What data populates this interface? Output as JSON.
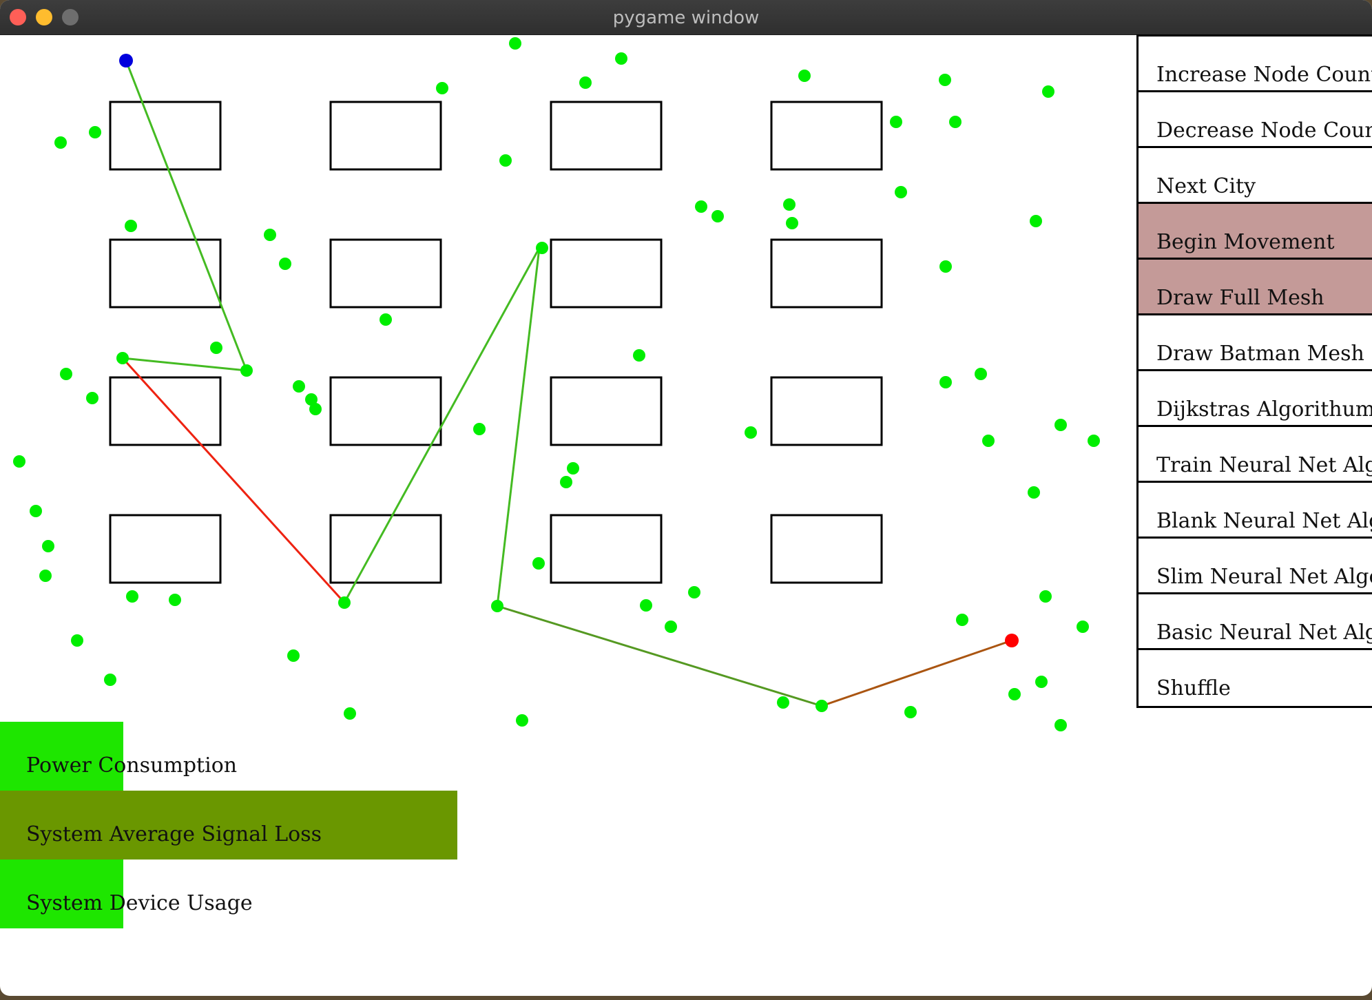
{
  "window": {
    "title": "pygame window",
    "traffic_lights": [
      {
        "name": "close",
        "color": "#ff5f57"
      },
      {
        "name": "minimize",
        "color": "#febc2e"
      },
      {
        "name": "zoom",
        "color": "#6e6e6e"
      }
    ]
  },
  "colors": {
    "node": "#00ee00",
    "start_node": "#0000dd",
    "end_node": "#ff0000",
    "path_green": "#44bb22",
    "path_red": "#ee2211",
    "path_olive": "#559922",
    "path_brown": "#aa5511",
    "button_active": "#c49a98",
    "meter_bright": "#1ee600",
    "meter_olive": "#6a9700"
  },
  "menu": {
    "buttons": [
      {
        "label": "Increase Node Count",
        "active": false
      },
      {
        "label": "Decrease Node Count",
        "active": false
      },
      {
        "label": "Next City",
        "active": false
      },
      {
        "label": "Begin Movement",
        "active": true
      },
      {
        "label": "Draw Full Mesh",
        "active": true
      },
      {
        "label": "Draw Batman Mesh",
        "active": false
      },
      {
        "label": "Dijkstras Algorithum",
        "active": false
      },
      {
        "label": "Train Neural Net Algorithum",
        "active": false
      },
      {
        "label": "Blank Neural Net Algorithum",
        "active": false
      },
      {
        "label": "Slim Neural Net Algorithum",
        "active": false
      },
      {
        "label": "Basic Neural Net Algorithum",
        "active": false
      },
      {
        "label": "Shuffle",
        "active": false
      }
    ]
  },
  "meters": [
    {
      "label": "Power Consumption",
      "level": 0.27,
      "color": "#1ee600"
    },
    {
      "label": "System Average Signal Loss",
      "level": 1.0,
      "color": "#6a9700"
    },
    {
      "label": "System Device Usage",
      "level": 0.27,
      "color": "#1ee600"
    }
  ],
  "city": {
    "grid": {
      "rows": 4,
      "columns": 4
    }
  }
}
